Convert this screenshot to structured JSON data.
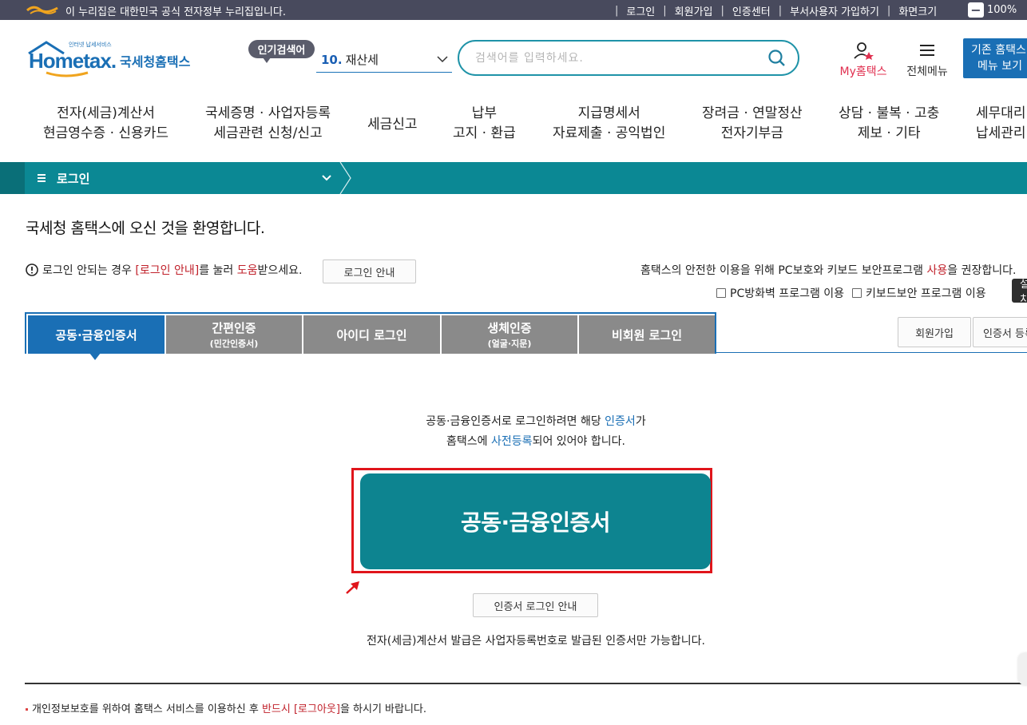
{
  "topbar": {
    "gov_notice": "이 누리집은 대한민국 공식 전자정부 누리집입니다.",
    "links": [
      "로그인",
      "회원가입",
      "인증센터",
      "부서사용자 가입하기",
      "화면크기"
    ],
    "zoom_minus": "−",
    "zoom_value": "100%"
  },
  "header": {
    "logo_sub": "인터넷 납세서비스",
    "logo_main": "Hometax.",
    "logo_kr": "국세청홈택스",
    "popular_label": "인기검색어",
    "popular_num": "10.",
    "popular_term": "재산세",
    "search_placeholder": "검색어를 입력하세요.",
    "my_label_pre": "My",
    "my_label": "홈택스",
    "allmenu_label": "전체메뉴",
    "oldmenu_line1": "기존 홈택스",
    "oldmenu_line2": "메뉴 보기"
  },
  "gnb": [
    {
      "l1": "전자(세금)계산서",
      "l2": "현금영수증 · 신용카드"
    },
    {
      "l1": "국세증명 · 사업자등록",
      "l2": "세금관련 신청/신고"
    },
    {
      "l1": "세금신고",
      "l2": ""
    },
    {
      "l1": "납부",
      "l2": "고지 · 환급"
    },
    {
      "l1": "지급명세서",
      "l2": "자료제출 · 공익법인"
    },
    {
      "l1": "장려금 · 연말정산",
      "l2": "전자기부금"
    },
    {
      "l1": "상담 · 불복 · 고충",
      "l2": "제보 · 기타"
    },
    {
      "l1": "세무대리",
      "l2": "납세관리"
    }
  ],
  "lnb": {
    "crumb": "로그인"
  },
  "content": {
    "welcome": "국세청 홈택스에 오신 것을 환영합니다.",
    "notice_pre": "로그인 안되는 경우",
    "notice_link": "[로그인 안내]",
    "notice_mid": "를 눌러",
    "notice_help": "도움",
    "notice_post": "받으세요.",
    "guide_btn": "로그인 안내",
    "security_pre": "홈택스의 안전한 이용을 위해 PC보호와 키보드 보안프로그램",
    "security_use": "사용",
    "security_post": "을 권장합니다.",
    "check_pc": "PC방화벽 프로그램 이용",
    "check_kb": "키보드보안 프로그램 이용",
    "check_btn": "설치"
  },
  "tabs": [
    {
      "label": "공동·금융인증서",
      "sub": ""
    },
    {
      "label": "간편인증",
      "sub": "(민간인증서)"
    },
    {
      "label": "아이디 로그인",
      "sub": ""
    },
    {
      "label": "생체인증",
      "sub": "(얼굴·지문)"
    },
    {
      "label": "비회원 로그인",
      "sub": ""
    }
  ],
  "side_buttons": {
    "join": "회원가입",
    "cert_reg": "인증서 등록"
  },
  "cert_panel": {
    "line1_pre": "공동·금융인증서로 로그인하려면 해당",
    "line1_link": "인증서",
    "line1_post": "가",
    "line2_pre": "홈택스에",
    "line2_link": "사전등록",
    "line2_post": "되어 있어야 합니다.",
    "main_button": "공동·금융인증서",
    "guide_button": "인증서 로그인 안내",
    "note": "전자(세금)계산서 발급은 사업자등록번호로 발급된 인증서만 가능합니다."
  },
  "footer_note": {
    "pre": "개인정보보호를 위하여 홈택스 서비스를 이용하신 후",
    "red": "반드시 [로그아웃]",
    "post": "을 하시기 바랍니다."
  },
  "colors": {
    "teal": "#0b8894",
    "blue": "#1a6fb5",
    "button_teal": "#0d8490",
    "highlight_red": "#e0151b"
  }
}
